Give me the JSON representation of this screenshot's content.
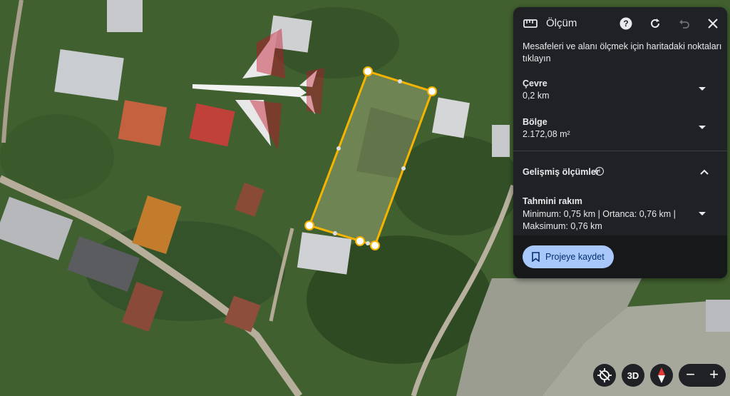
{
  "panel": {
    "title": "Ölçüm",
    "description": "Mesafeleri ve alanı ölçmek için haritadaki noktaları tıklayın",
    "perimeter": {
      "label": "Çevre",
      "value": "0,2 km"
    },
    "area": {
      "label": "Bölge",
      "value": "2.172,08 m²"
    },
    "advanced": {
      "label": "Gelişmiş ölçümler",
      "info_glyph": "i"
    },
    "elevation": {
      "label": "Tahmini rakım",
      "value": "Minimum: 0,75 km | Ortanca: 0,76 km | Maksimum: 0,76 km"
    },
    "save_label": "Projeye kaydet"
  },
  "controls": {
    "three_d_label": "3D",
    "zoom_out_label": "−",
    "zoom_in_label": "+"
  },
  "colors": {
    "panel_bg": "#202124",
    "measure_line": "#f4b400",
    "save_button": "#a8c7fa"
  },
  "icons": [
    "ruler-icon",
    "help-icon",
    "refresh-icon",
    "undo-icon",
    "close-icon",
    "bookmark-icon",
    "location-reset-icon",
    "compass-icon"
  ]
}
